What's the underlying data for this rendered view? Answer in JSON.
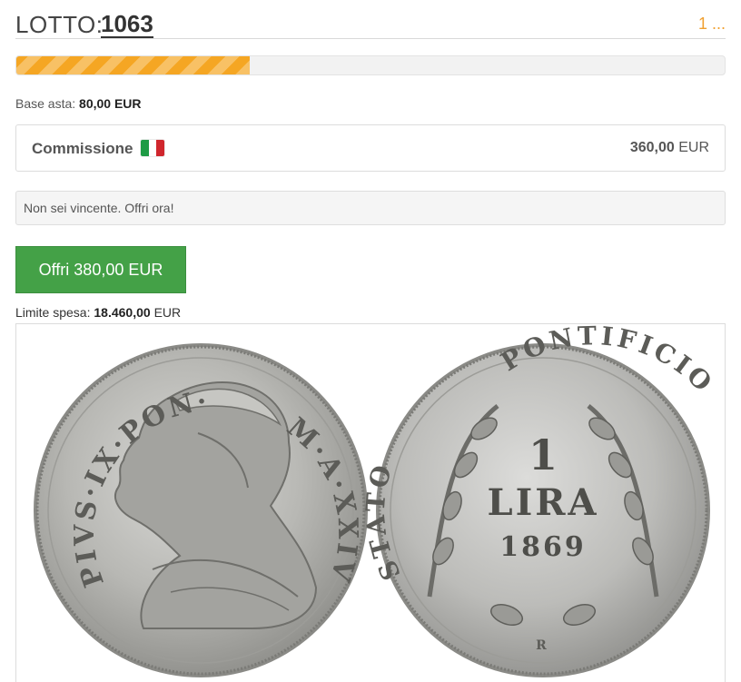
{
  "lot": {
    "prefix": "LOTTO:",
    "number": "1063",
    "pager": "1 ..."
  },
  "progress": {
    "fraction": 0.33,
    "color": "#f5a623"
  },
  "base_asta": {
    "label": "Base asta:",
    "value": "80,00 EUR"
  },
  "commission": {
    "label": "Commissione",
    "flag_icon": "italy-flag-icon",
    "amount": "360,00",
    "currency": "EUR"
  },
  "notice": {
    "text": "Non sei vincente. Offri ora!"
  },
  "offer_button": {
    "label": "Offri 380,00 EUR",
    "color": "#44a147"
  },
  "limit": {
    "label": "Limite spesa:",
    "value": "18.460,00",
    "currency": "EUR"
  },
  "coin": {
    "obverse_legend_left": "PIVS·IX·PON·",
    "obverse_legend_right": "M·A·XXIV",
    "reverse_legend_left": "STATO",
    "reverse_legend_top": "PONTIFICIO",
    "reverse_value": "1",
    "reverse_unit": "LIRA",
    "reverse_year": "1869",
    "mint_mark": "R"
  }
}
